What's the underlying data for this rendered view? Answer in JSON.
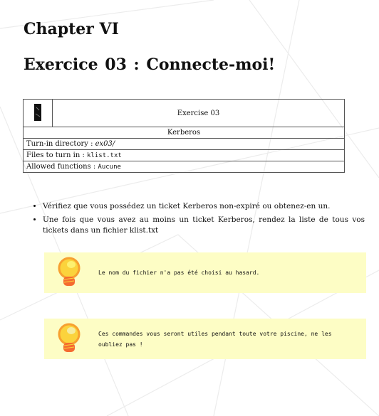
{
  "chapter": "Chapter VI",
  "exercise_title": "Exercice 03 : Connecte-moi!",
  "header_table": {
    "exercise": "Exercise 03",
    "topic": "Kerberos",
    "turn_in_label": "Turn-in directory : ",
    "turn_in_value": "ex03/",
    "files_label": "Files to turn in : ",
    "files_value": "klist.txt",
    "allowed_label": "Allowed functions : ",
    "allowed_value": "Aucune"
  },
  "bullets": [
    "Vérifiez que vous possédez un ticket Kerberos non-expiré ou obtenez-en un.",
    "Une fois que vous avez au moins un ticket Kerberos, rendez la liste de tous vos tickets dans un fichier klist.txt"
  ],
  "hints": [
    "Le nom du fichier n'a pas été choisi au hasard.",
    "Ces commandes vous seront utiles pendant toute votre piscine, ne les oubliez pas !"
  ]
}
